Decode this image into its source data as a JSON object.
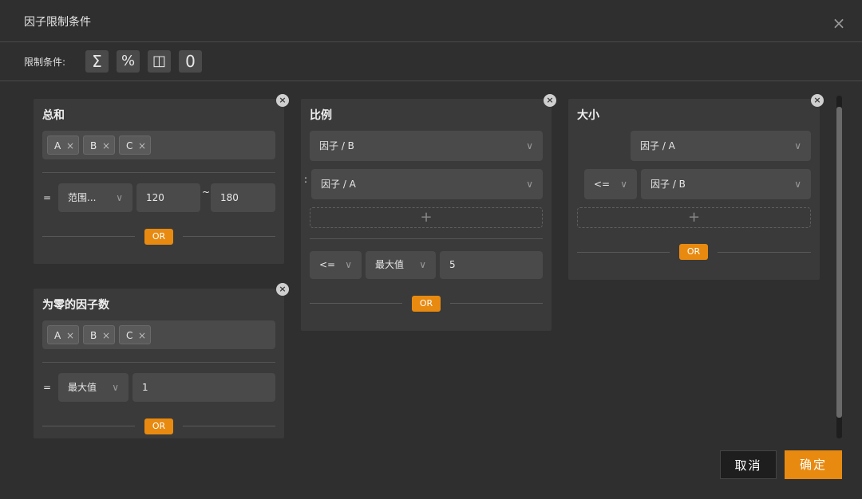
{
  "dialog": {
    "title": "因子限制条件",
    "close": "×"
  },
  "toolbar": {
    "label": "限制条件:",
    "buttons": [
      {
        "symbol": "Σ",
        "icon": "sum-icon"
      },
      {
        "symbol": "%",
        "icon": "percent-icon"
      },
      {
        "symbol": "◫",
        "icon": "compare-icon"
      },
      {
        "symbol": "0",
        "icon": "zero-icon"
      }
    ]
  },
  "cards": {
    "sum": {
      "title": "总和",
      "tags": [
        "A",
        "B",
        "C"
      ],
      "op": "=",
      "mode": "范围...",
      "min": "120",
      "tilde": "~",
      "max": "180",
      "or": "OR"
    },
    "zero": {
      "title": "为零的因子数",
      "tags": [
        "A",
        "B",
        "C"
      ],
      "op": "=",
      "mode": "最大值",
      "value": "1",
      "or": "OR"
    },
    "ratio": {
      "title": "比例",
      "numerator": "因子 / B",
      "colon": ":",
      "denominator": "因子 / A",
      "add": "+",
      "op": "<=",
      "mode": "最大值",
      "value": "5",
      "or": "OR"
    },
    "size": {
      "title": "大小",
      "left": "因子 / A",
      "op": "<=",
      "right": "因子 / B",
      "add": "+",
      "or": "OR"
    }
  },
  "tag_remove": "×",
  "arrow": "∨",
  "footer": {
    "cancel": "取消",
    "ok": "确定"
  },
  "colors": {
    "accent": "#e88a10",
    "panel": "#3a3a3a",
    "field": "#4a4a4a",
    "background": "#2f2f2f"
  }
}
